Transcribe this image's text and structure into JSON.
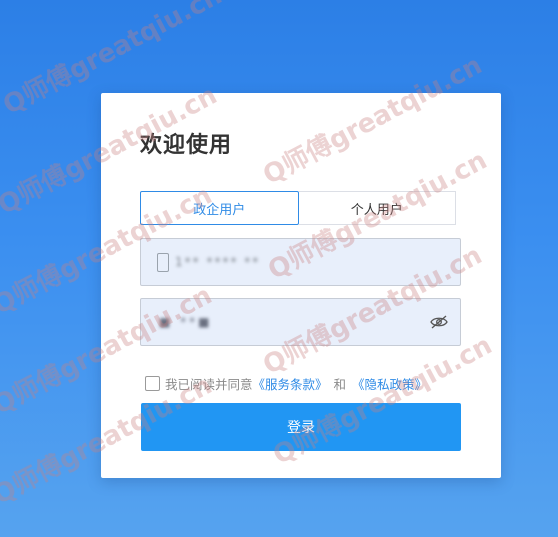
{
  "login": {
    "title": "欢迎使用",
    "tabs": [
      {
        "label": "政企用户",
        "active": true
      },
      {
        "label": "个人用户",
        "active": false
      }
    ],
    "phone_value": "1** **** **",
    "password_value": "■ **■",
    "agree_prefix": "我已阅读并同意",
    "terms_link": "《服务条款》",
    "and_text": "和",
    "privacy_link": "《隐私政策》",
    "login_button": "登录"
  },
  "watermark": {
    "text": "Q师傅greatqiu.cn"
  },
  "colors": {
    "accent": "#2196f3",
    "link": "#2f8be6",
    "background_top": "#2c7fe6",
    "background_bottom": "#56a3ef",
    "field_bg": "#e8effb"
  },
  "icons": {
    "phone": "phone-icon",
    "password_visibility": "eye-off-icon"
  }
}
